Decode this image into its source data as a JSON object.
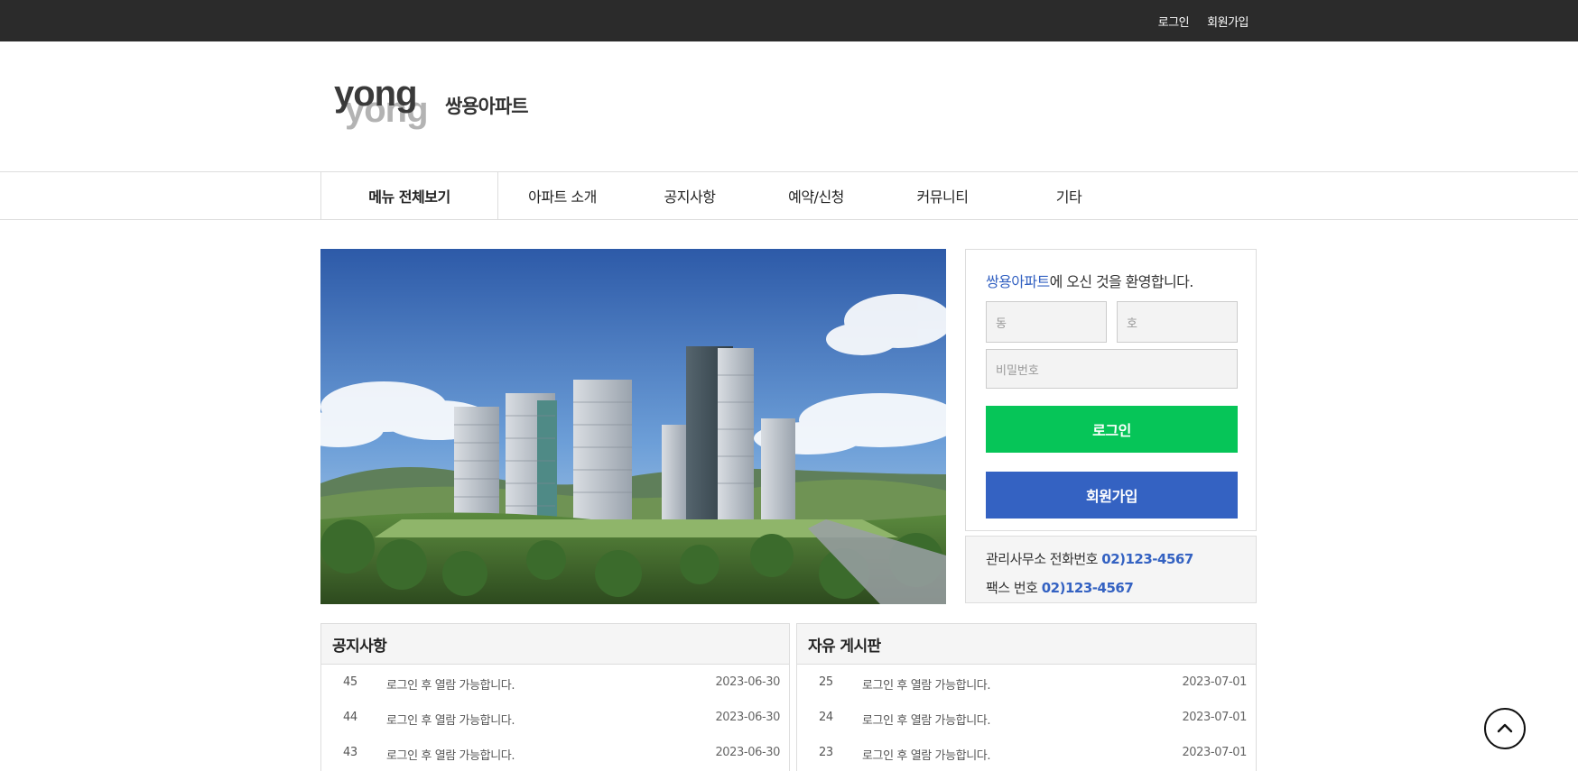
{
  "topbar": {
    "login": "로그인",
    "signup": "회원가입"
  },
  "logo": {
    "mark": "yong",
    "name": "쌍용아파트"
  },
  "nav": {
    "all_menu": "메뉴 전체보기",
    "items": [
      "아파트 소개",
      "공지사항",
      "예약/신청",
      "커뮤니티",
      "기타"
    ]
  },
  "login_box": {
    "welcome_brand": "쌍용아파트",
    "welcome_rest": "에 오신 것을 환영합니다.",
    "dong_placeholder": "동",
    "ho_placeholder": "호",
    "password_placeholder": "비밀번호",
    "login_button": "로그인",
    "signup_button": "회원가입"
  },
  "contact": {
    "office_label": "관리사무소 전화번호",
    "office_number": "02)123-4567",
    "fax_label": "팩스 번호",
    "fax_number": "02)123-4567"
  },
  "notice_board": {
    "title": "공지사항",
    "rows": [
      {
        "no": "45",
        "title": "로그인 후 열람 가능합니다.",
        "date": "2023-06-30"
      },
      {
        "no": "44",
        "title": "로그인 후 열람 가능합니다.",
        "date": "2023-06-30"
      },
      {
        "no": "43",
        "title": "로그인 후 열람 가능합니다.",
        "date": "2023-06-30"
      }
    ]
  },
  "free_board": {
    "title": "자유 게시판",
    "rows": [
      {
        "no": "25",
        "title": "로그인 후 열람 가능합니다.",
        "date": "2023-07-01"
      },
      {
        "no": "24",
        "title": "로그인 후 열람 가능합니다.",
        "date": "2023-07-01"
      },
      {
        "no": "23",
        "title": "로그인 후 열람 가능합니다.",
        "date": "2023-07-01"
      }
    ]
  },
  "icons": {
    "scroll_top": "chevron-up-circle-icon"
  },
  "colors": {
    "accent_blue": "#3462c2",
    "login_green": "#06c558",
    "topbar": "#2b2b2b"
  }
}
